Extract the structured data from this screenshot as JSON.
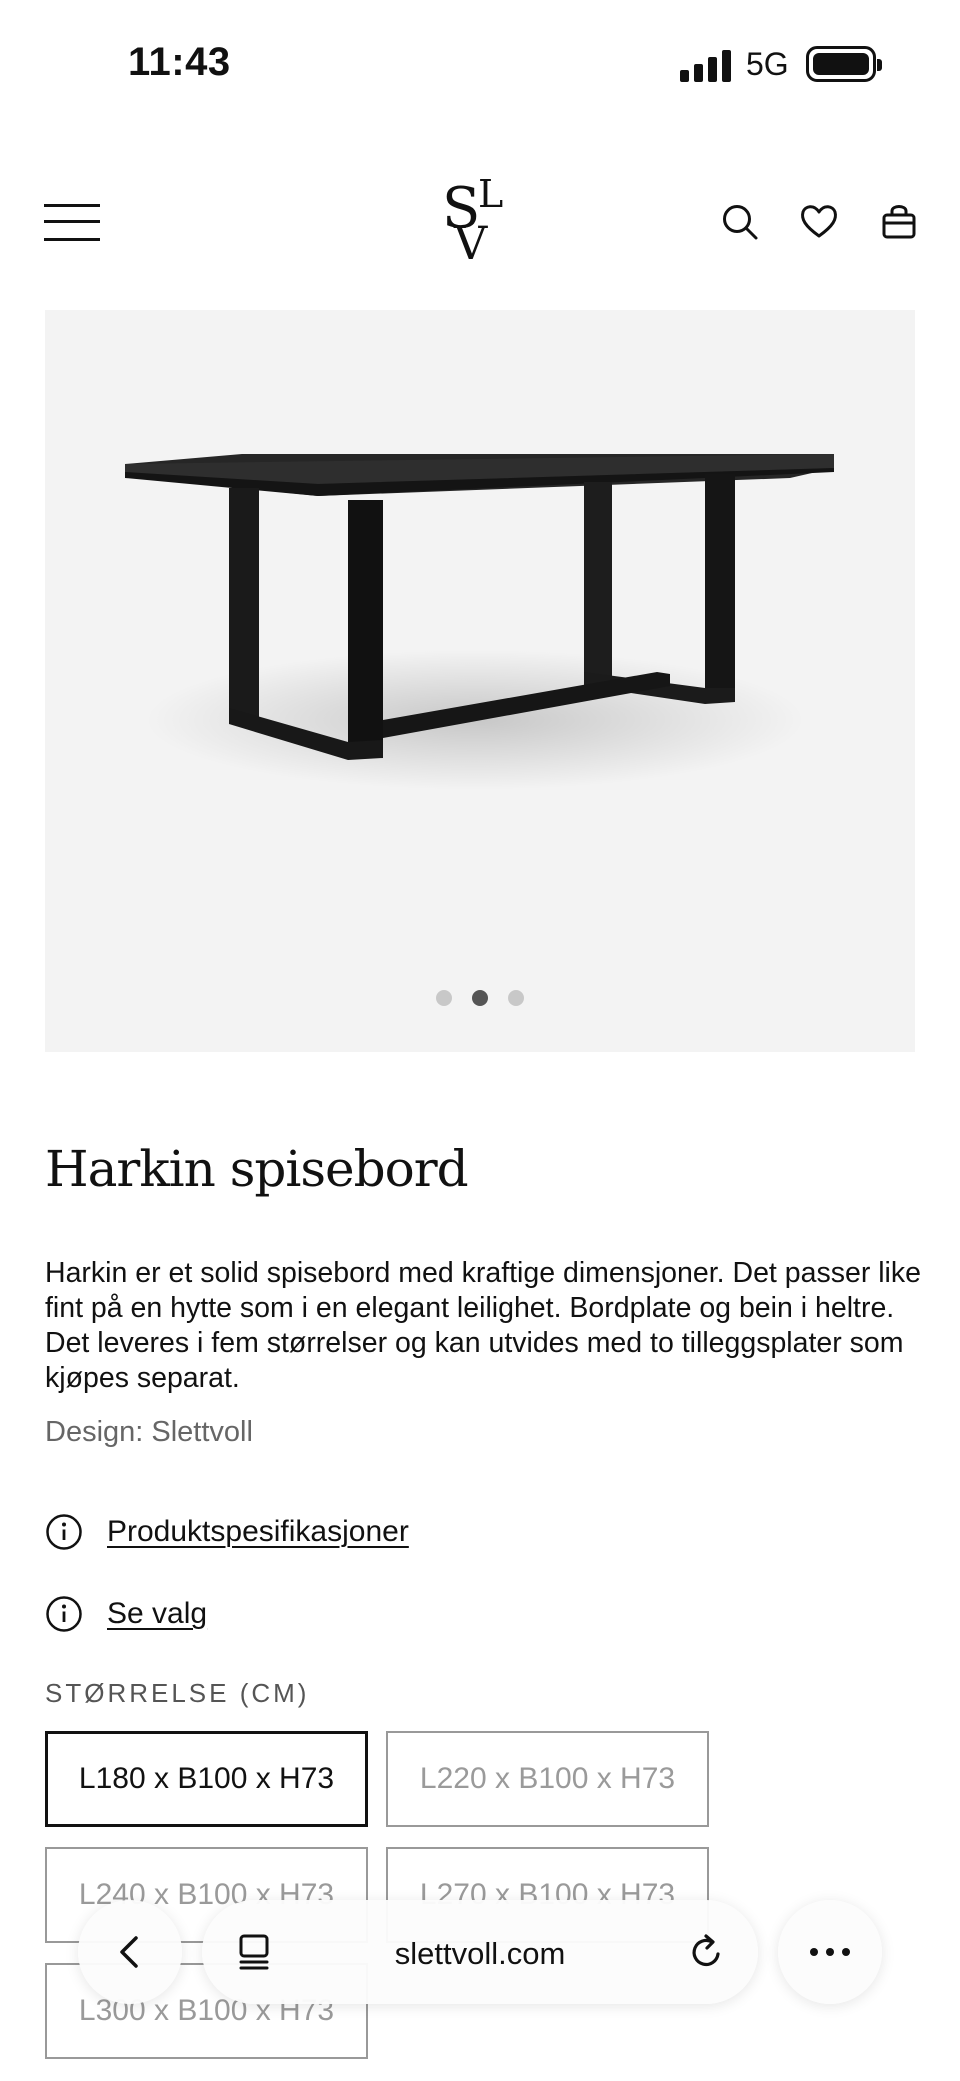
{
  "status_bar": {
    "time": "11:43",
    "network": "5G"
  },
  "header": {
    "logo": "SLV",
    "icons": [
      "menu-icon",
      "search-icon",
      "heart-icon",
      "cart-icon"
    ]
  },
  "gallery": {
    "slide_count": 3,
    "active_index": 1
  },
  "product": {
    "title": "Harkin spisebord",
    "description": "Harkin er et solid spisebord med kraftige dimensjoner. Det passer like fint på en hytte som i en elegant leilighet. Bordplate og bein i heltre. Det leveres i fem størrelser og kan utvides med to tilleggsplater som kjøpes separat.",
    "designer": "Design: Slettvoll",
    "links": {
      "specs": "Produktspesifikasjoner",
      "options": "Se valg"
    },
    "size_label": "STØRRELSE (CM)",
    "sizes": [
      "L180 x B100 x H73",
      "L220 x B100 x H73",
      "L240 x B100 x H73",
      "L270 x B100 x H73",
      "L300 x B100 x H73"
    ],
    "selected_size": "L180 x B100 x H73"
  },
  "browser": {
    "url": "slettvoll.com"
  },
  "colors": {
    "text": "#111111",
    "muted": "#666666",
    "image_bg": "#f3f3f3",
    "table": "#1c1c1c"
  }
}
